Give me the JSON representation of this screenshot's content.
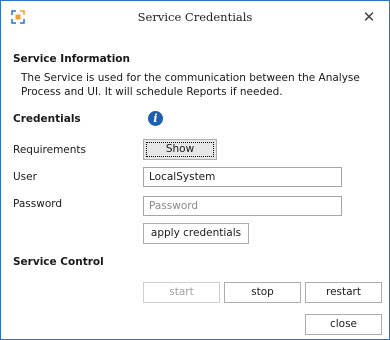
{
  "window": {
    "title": "Service Credentials",
    "close_glyph": "✕"
  },
  "service_info": {
    "heading": "Service Information",
    "description": "The Service is used for the communication between the Analyse Process and UI. It will schedule Reports if needed."
  },
  "credentials": {
    "heading": "Credentials",
    "info_glyph": "i",
    "requirements_label": "Requirements",
    "show_button": "Show",
    "user_label": "User",
    "user_value": "LocalSystem",
    "password_label": "Password",
    "password_placeholder": "Password",
    "apply_button": "apply credentials"
  },
  "service_control": {
    "heading": "Service Control",
    "start_button": "start",
    "stop_button": "stop",
    "restart_button": "restart"
  },
  "footer": {
    "close_button": "close"
  },
  "colors": {
    "border": "#2b72c8",
    "info_icon": "#1f5fb0"
  }
}
